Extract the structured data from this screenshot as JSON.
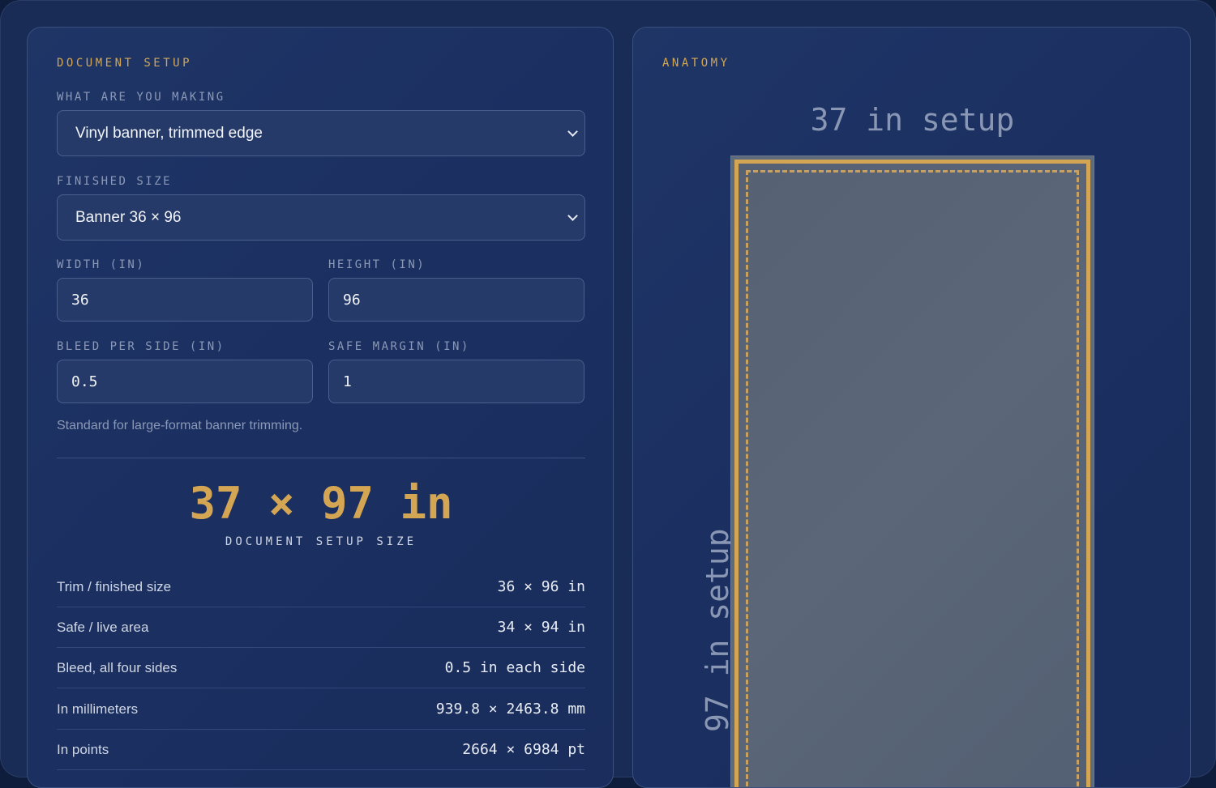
{
  "document_setup": {
    "heading": "DOCUMENT SETUP",
    "making_label": "WHAT ARE YOU MAKING",
    "making_value": "Vinyl banner, trimmed edge",
    "finished_label": "FINISHED SIZE",
    "finished_value": "Banner 36 × 96",
    "width_label": "WIDTH (IN)",
    "width_value": "36",
    "height_label": "HEIGHT (IN)",
    "height_value": "96",
    "bleed_label": "BLEED PER SIDE (IN)",
    "bleed_value": "0.5",
    "safe_label": "SAFE MARGIN (IN)",
    "safe_value": "1",
    "hint": "Standard for large-format banner trimming.",
    "result_size": "37 × 97 in",
    "result_caption": "DOCUMENT SETUP SIZE",
    "specs": [
      {
        "label": "Trim / finished size",
        "value": "36 × 96 in"
      },
      {
        "label": "Safe / live area",
        "value": "34 × 94 in"
      },
      {
        "label": "Bleed, all four sides",
        "value": "0.5 in each side"
      },
      {
        "label": "In millimeters",
        "value": "939.8 × 2463.8 mm"
      },
      {
        "label": "In points",
        "value": "2664 × 6984 pt"
      }
    ]
  },
  "anatomy": {
    "heading": "ANATOMY",
    "width_label": "37 in setup",
    "height_label": "97 in setup"
  },
  "colors": {
    "accent": "#d4a653",
    "background": "#192c55",
    "panel": "#1f3566",
    "muted_text": "#8c99b6"
  }
}
